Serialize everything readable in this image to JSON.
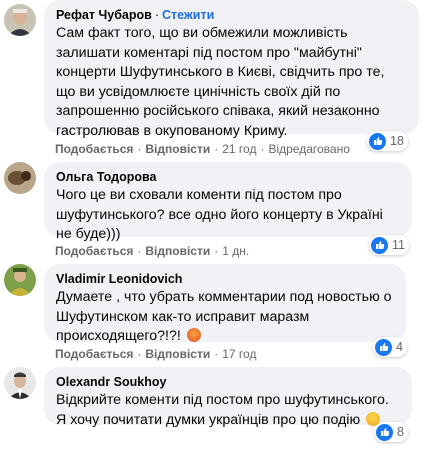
{
  "comments": [
    {
      "author": "Рефат Чубаров",
      "follow_label": "Стежити",
      "text": "Сам факт того, що ви обмежили можливість залишати коментарі під постом про \"майбутні\" концерти Шуфутинського в Києві, свідчить про те, що ви усвідомлюєте цинічність своїх дій по запрошенню російського співака, який незаконно гастролював в окупованому Криму.",
      "reaction_count": "18",
      "like_label": "Подобається",
      "reply_label": "Відповісти",
      "time": "21 год",
      "edited_label": "Відредаговано"
    },
    {
      "author": "Ольга Тодорова",
      "text": "Чого це ви сховали коменти під постом про шуфутинського? все одно його концерту в Україні не буде)))",
      "reaction_count": "11",
      "like_label": "Подобається",
      "reply_label": "Відповісти",
      "time": "1 дн."
    },
    {
      "author": "Vladimir Leonidovich",
      "text": "Думаете , что убрать комментарии под новостью о Шуфутинском как-то исправит маразм происходящего?!?!",
      "reaction_count": "4",
      "like_label": "Подобається",
      "reply_label": "Відповісти",
      "time": "17 год"
    },
    {
      "author": "Olexandr Soukhoy",
      "text": "Відкрийте коменти під постом про шуфутинського. Я хочу почитати думки українців про цю подію",
      "reaction_count": "8"
    }
  ],
  "colors": {
    "bubble": "#f0f2f5",
    "link": "#216fdb",
    "secondary_text": "#65676b",
    "like_blue": "#1877f2"
  },
  "icons": {
    "reaction": "thumbs-up-icon",
    "angry_emoji": "angry-face-icon",
    "laughing_emoji": "rolling-laughing-face-icon"
  }
}
